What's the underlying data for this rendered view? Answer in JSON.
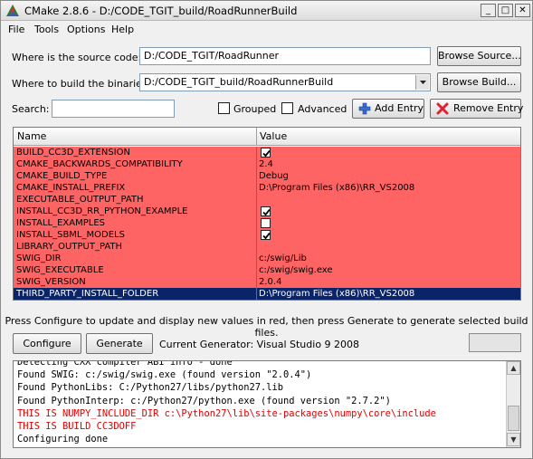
{
  "window": {
    "title": "CMake 2.8.6 - D:/CODE_TGIT_build/RoadRunnerBuild",
    "minimize": "_",
    "maximize": "□",
    "close": "✕"
  },
  "menu": [
    "File",
    "Tools",
    "Options",
    "Help"
  ],
  "source": {
    "label": "Where is the source code:",
    "value": "D:/CODE_TGIT/RoadRunner",
    "button": "Browse Source..."
  },
  "build": {
    "label": "Where to build the binaries:",
    "value": "D:/CODE_TGIT_build/RoadRunnerBuild",
    "button": "Browse Build..."
  },
  "search": {
    "label": "Search:",
    "value": ""
  },
  "options": {
    "grouped": {
      "label": "Grouped",
      "checked": false
    },
    "advanced": {
      "label": "Advanced",
      "checked": false
    }
  },
  "buttons": {
    "add_entry": "Add Entry",
    "remove_entry": "Remove Entry",
    "configure": "Configure",
    "generate": "Generate"
  },
  "table": {
    "headers": [
      "Name",
      "Value"
    ],
    "rows": [
      {
        "name": "BUILD_CC3D_EXTENSION",
        "value": "",
        "checkbox": true,
        "checked": true
      },
      {
        "name": "CMAKE_BACKWARDS_COMPATIBILITY",
        "value": "2.4"
      },
      {
        "name": "CMAKE_BUILD_TYPE",
        "value": "Debug"
      },
      {
        "name": "CMAKE_INSTALL_PREFIX",
        "value": "D:\\Program Files (x86)\\RR_VS2008"
      },
      {
        "name": "EXECUTABLE_OUTPUT_PATH",
        "value": ""
      },
      {
        "name": "INSTALL_CC3D_RR_PYTHON_EXAMPLE",
        "value": "",
        "checkbox": true,
        "checked": true
      },
      {
        "name": "INSTALL_EXAMPLES",
        "value": "",
        "checkbox": true,
        "checked": false
      },
      {
        "name": "INSTALL_SBML_MODELS",
        "value": "",
        "checkbox": true,
        "checked": true
      },
      {
        "name": "LIBRARY_OUTPUT_PATH",
        "value": ""
      },
      {
        "name": "SWIG_DIR",
        "value": "c:/swig/Lib"
      },
      {
        "name": "SWIG_EXECUTABLE",
        "value": "c:/swig/swig.exe"
      },
      {
        "name": "SWIG_VERSION",
        "value": "2.0.4"
      },
      {
        "name": "THIRD_PARTY_INSTALL_FOLDER",
        "value": "D:\\Program Files (x86)\\RR_VS2008",
        "selected": true
      }
    ]
  },
  "hint": "Press Configure to update and display new values in red, then press Generate to generate selected build files.",
  "generator": "Current Generator: Visual Studio 9 2008",
  "log": [
    {
      "text": "Detecting CXX compiler ABI info - done",
      "red": false
    },
    {
      "text": "Found SWIG: c:/swig/swig.exe (found version \"2.0.4\")",
      "red": false
    },
    {
      "text": "Found PythonLibs: C:/Python27/libs/python27.lib",
      "red": false
    },
    {
      "text": "Found PythonInterp: c:/Python27/python.exe (found version \"2.7.2\")",
      "red": false
    },
    {
      "text": "THIS IS NUMPY_INCLUDE_DIR c:\\Python27\\lib\\site-packages\\numpy\\core\\include",
      "red": true
    },
    {
      "text": "THIS IS BUILD CC3DOFF",
      "red": true
    },
    {
      "text": "Configuring done",
      "red": false
    }
  ],
  "colors": {
    "changed_row": "#ff6464",
    "selected_row": "#0a246a",
    "log_error": "#e00000"
  }
}
